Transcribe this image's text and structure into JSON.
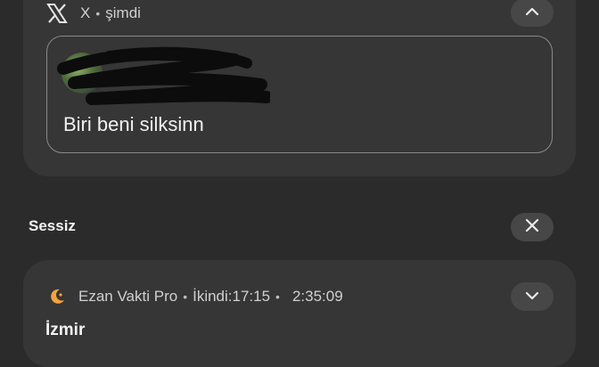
{
  "x_notification": {
    "app_name": "X",
    "separator": "•",
    "time": "şimdi",
    "tweet_text": "Biri beni silksinn",
    "icon": "x-logo-icon",
    "collapse_icon": "chevron-up-icon"
  },
  "silent_section": {
    "label": "Sessiz",
    "dismiss_icon": "close-icon"
  },
  "prayer_notification": {
    "app_name": "Ezan Vakti Pro",
    "separator1": "•",
    "prayer_time": "İkindi:17:15",
    "separator2": "•",
    "countdown": "2:35:09",
    "city": "İzmir",
    "icon": "crescent-moon-icon",
    "icon_color": "#f5a33b",
    "expand_icon": "chevron-down-icon"
  }
}
